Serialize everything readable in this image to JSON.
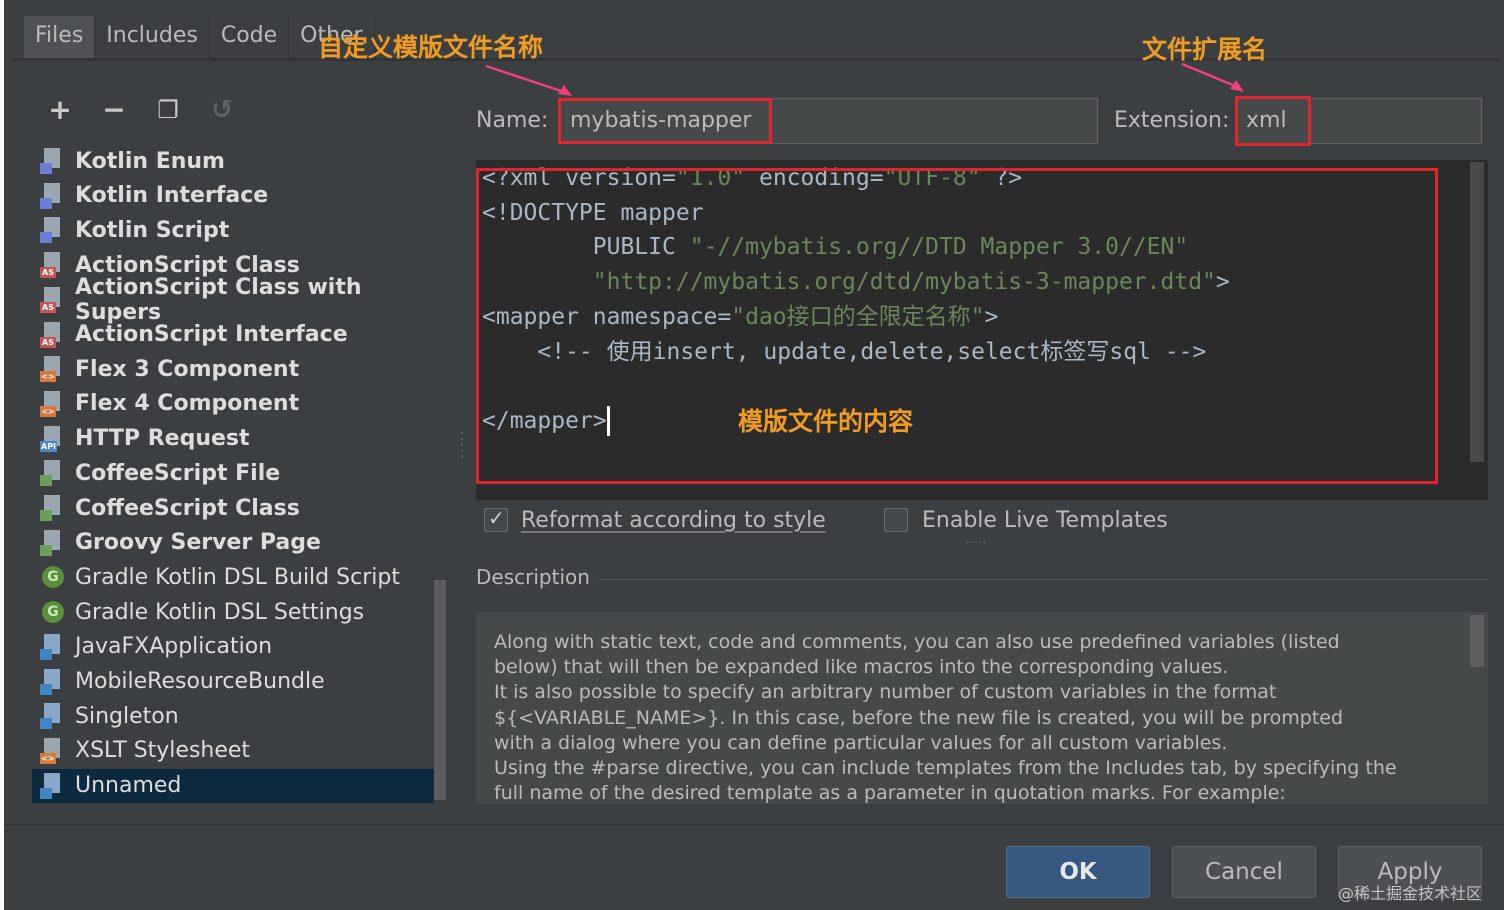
{
  "tabs": [
    "Files",
    "Includes",
    "Code",
    "Other"
  ],
  "toolbar": {
    "add": "+",
    "remove": "−",
    "copy": "❐",
    "reset": "↺"
  },
  "templates": [
    {
      "label": "Kotlin Enum",
      "icon": "kotlin-file-icon",
      "badge": "",
      "bold": true
    },
    {
      "label": "Kotlin Interface",
      "icon": "kotlin-file-icon",
      "badge": "",
      "bold": true
    },
    {
      "label": "Kotlin Script",
      "icon": "kotlin-file-icon",
      "badge": "",
      "bold": true
    },
    {
      "label": "ActionScript Class",
      "icon": "actionscript-file-icon",
      "badge": "AS",
      "bold": true
    },
    {
      "label": "ActionScript Class with Supers",
      "icon": "actionscript-file-icon",
      "badge": "AS",
      "bold": true
    },
    {
      "label": "ActionScript Interface",
      "icon": "actionscript-file-icon",
      "badge": "AS",
      "bold": true
    },
    {
      "label": "Flex 3 Component",
      "icon": "flex-file-icon",
      "badge": "<>",
      "bold": true
    },
    {
      "label": "Flex 4 Component",
      "icon": "flex-file-icon",
      "badge": "<>",
      "bold": true
    },
    {
      "label": "HTTP Request",
      "icon": "http-api-file-icon",
      "badge": "API",
      "bold": true
    },
    {
      "label": "CoffeeScript File",
      "icon": "coffeescript-file-icon",
      "badge": "",
      "bold": true
    },
    {
      "label": "CoffeeScript Class",
      "icon": "coffeescript-file-icon",
      "badge": "",
      "bold": true
    },
    {
      "label": "Groovy Server Page",
      "icon": "groovy-file-icon",
      "badge": "",
      "bold": true
    },
    {
      "label": "Gradle Kotlin DSL Build Script",
      "icon": "gradle-icon",
      "badge": "G",
      "bold": false
    },
    {
      "label": "Gradle Kotlin DSL Settings",
      "icon": "gradle-icon",
      "badge": "G",
      "bold": false
    },
    {
      "label": "JavaFXApplication",
      "icon": "java-file-icon",
      "badge": "",
      "bold": false
    },
    {
      "label": "MobileResourceBundle",
      "icon": "java-file-icon",
      "badge": "",
      "bold": false
    },
    {
      "label": "Singleton",
      "icon": "java-file-icon",
      "badge": "",
      "bold": false
    },
    {
      "label": "XSLT Stylesheet",
      "icon": "xslt-file-icon",
      "badge": "<>",
      "bold": false
    },
    {
      "label": "Unnamed",
      "icon": "java-file-icon",
      "badge": "",
      "bold": false,
      "selected": true
    }
  ],
  "name_field": {
    "label": "Name:",
    "value": "mybatis-mapper"
  },
  "extension_field": {
    "label": "Extension:",
    "value": "xml"
  },
  "annotations": {
    "name": "自定义模版文件名称",
    "extension": "文件扩展名",
    "content": "模版文件的内容"
  },
  "code_lines": [
    [
      {
        "t": "<?xml version=",
        "c": "plain"
      },
      {
        "t": "\"1.0\"",
        "c": "str"
      },
      {
        "t": " encoding=",
        "c": "plain"
      },
      {
        "t": "\"UTF-8\"",
        "c": "str"
      },
      {
        "t": " ?>",
        "c": "plain"
      }
    ],
    [
      {
        "t": "<!DOCTYPE mapper",
        "c": "plain"
      }
    ],
    [
      {
        "t": "        PUBLIC ",
        "c": "plain"
      },
      {
        "t": "\"-//mybatis.org//DTD Mapper 3.0//EN\"",
        "c": "str"
      }
    ],
    [
      {
        "t": "        ",
        "c": "plain"
      },
      {
        "t": "\"http://mybatis.org/dtd/mybatis-3-mapper.dtd\"",
        "c": "str"
      },
      {
        "t": ">",
        "c": "plain"
      }
    ],
    [
      {
        "t": "<mapper namespace=",
        "c": "plain"
      },
      {
        "t": "\"dao接口的全限定名称\"",
        "c": "str"
      },
      {
        "t": ">",
        "c": "plain"
      }
    ],
    [
      {
        "t": "    <!-- 使用insert, update,delete,select标签写sql -->",
        "c": "plain"
      }
    ],
    [
      {
        "t": "",
        "c": "plain"
      }
    ],
    [
      {
        "t": "</mapper>",
        "c": "plain"
      }
    ]
  ],
  "checkboxes": {
    "reformat": {
      "label": "Reformat according to style",
      "checked": true
    },
    "live_templates": {
      "label": "Enable Live Templates",
      "checked": false
    }
  },
  "description": {
    "title": "Description",
    "lines": [
      "Along with static text, code and comments, you can also use predefined variables (listed",
      "below) that will then be expanded like macros into the corresponding values.",
      "It is also possible to specify an arbitrary number of custom variables in the format",
      "${<VARIABLE_NAME>}. In this case, before the new file is created, you will be prompted",
      "with a dialog where you can define particular values for all custom variables.",
      "Using the #parse directive, you can include templates from the Includes tab, by specifying the",
      "full name of the desired template as a parameter in quotation marks. For example:"
    ]
  },
  "buttons": {
    "ok": "OK",
    "cancel": "Cancel",
    "apply": "Apply"
  },
  "watermark": "@稀土掘金技术社区",
  "colors": {
    "annotation": "#f29c1f",
    "highlight_box": "#e0262a",
    "selection": "#0d293e",
    "primary_button": "#365880"
  }
}
